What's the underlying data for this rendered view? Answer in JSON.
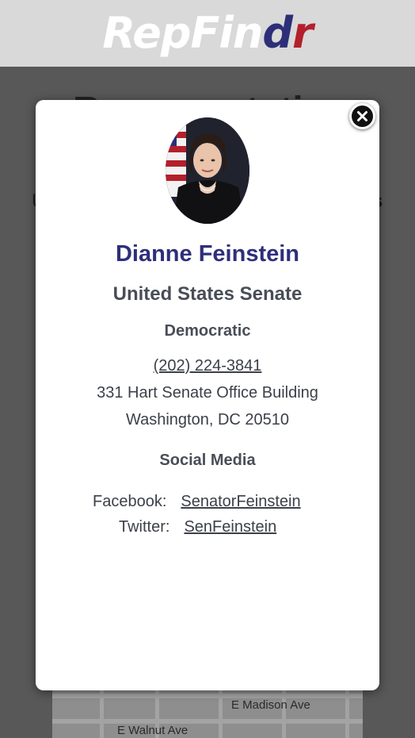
{
  "header": {
    "logo_part1": "RepFin",
    "logo_part2": "d",
    "logo_part3": "r"
  },
  "background": {
    "title": "Representatives",
    "side_left": "U",
    "side_right": "s",
    "map": {
      "street1": "E Madison Ave",
      "street2": "E Walnut Ave"
    }
  },
  "modal": {
    "name": "Dianne Feinstein",
    "chamber": "United States Senate",
    "party": "Democratic",
    "phone": "(202) 224-3841",
    "address_line1": "331 Hart Senate Office Building",
    "address_line2": "Washington, DC 20510",
    "social_heading": "Social Media",
    "facebook_label": "Facebook:",
    "facebook_handle": "SenatorFeinstein",
    "twitter_label": "Twitter:",
    "twitter_handle": "SenFeinstein"
  },
  "colors": {
    "brand_navy": "#2c2f77",
    "brand_red": "#b3202c",
    "header_bg": "#d9d9d9",
    "name_color": "#2e2f7a"
  },
  "icons": {
    "close": "close-icon",
    "portrait": "portrait-photo"
  }
}
